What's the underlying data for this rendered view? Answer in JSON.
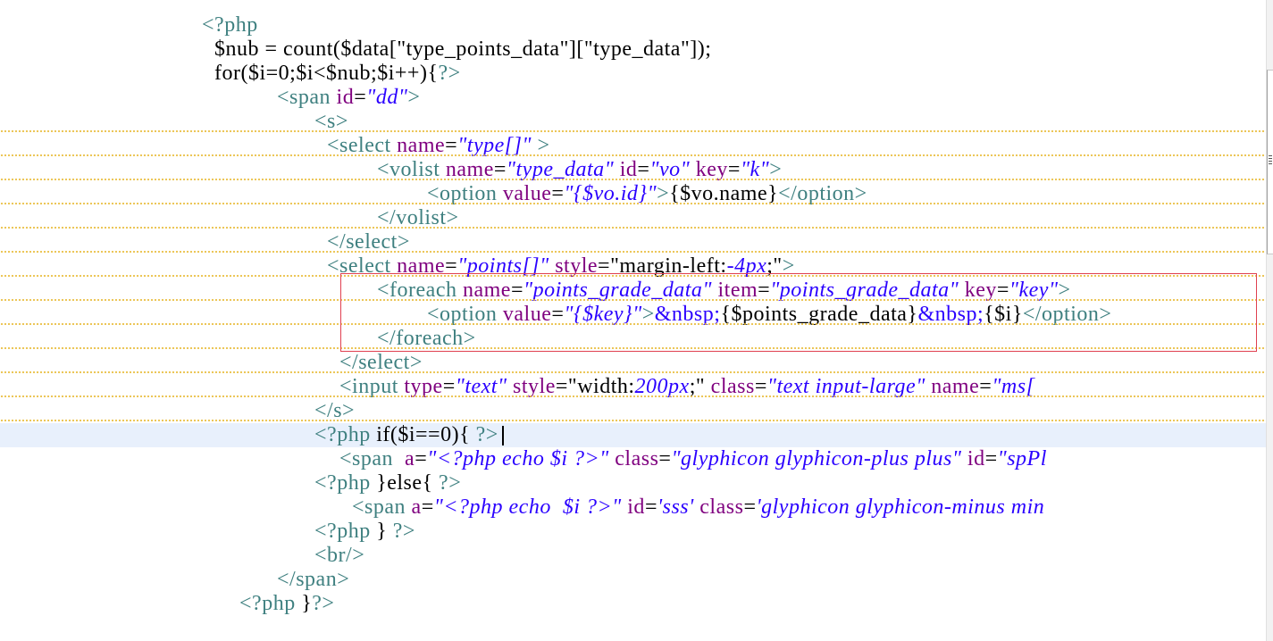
{
  "editor": {
    "language": "php/html template",
    "current_line": 17,
    "lines": [
      {
        "n": 1,
        "tokens": [
          {
            "t": "php",
            "v": "<?php"
          }
        ]
      },
      {
        "n": 2,
        "tokens": [
          {
            "t": "txt",
            "v": "$nub = count($data[\"type_points_data\"][\"type_data\"]);"
          }
        ]
      },
      {
        "n": 3,
        "tokens": [
          {
            "t": "txt",
            "v": "for($i=0;$i<$nub;$i++){"
          },
          {
            "t": "php",
            "v": "?>"
          }
        ]
      },
      {
        "n": 4,
        "tokens": [
          {
            "t": "tag",
            "v": "<span "
          },
          {
            "t": "attr",
            "v": "id"
          },
          {
            "t": "txt",
            "v": "="
          },
          {
            "t": "val",
            "v": "\"dd\""
          },
          {
            "t": "tag",
            "v": ">"
          }
        ]
      },
      {
        "n": 5,
        "tokens": [
          {
            "t": "tag",
            "v": "<s>"
          }
        ]
      },
      {
        "n": 6,
        "tokens": [
          {
            "t": "tag",
            "v": "<select "
          },
          {
            "t": "attr",
            "v": "name"
          },
          {
            "t": "txt",
            "v": "="
          },
          {
            "t": "val",
            "v": "\"type[]\""
          },
          {
            "t": "tag",
            "v": " >"
          }
        ]
      },
      {
        "n": 7,
        "tokens": [
          {
            "t": "tag",
            "v": "<volist "
          },
          {
            "t": "attr",
            "v": "name"
          },
          {
            "t": "txt",
            "v": "="
          },
          {
            "t": "val",
            "v": "\"type_data\""
          },
          {
            "t": "attr",
            "v": " id"
          },
          {
            "t": "txt",
            "v": "="
          },
          {
            "t": "val",
            "v": "\"vo\""
          },
          {
            "t": "attr",
            "v": " key"
          },
          {
            "t": "txt",
            "v": "="
          },
          {
            "t": "val",
            "v": "\"k\""
          },
          {
            "t": "tag",
            "v": ">"
          }
        ]
      },
      {
        "n": 8,
        "tokens": [
          {
            "t": "tag",
            "v": "<option "
          },
          {
            "t": "attr",
            "v": "value"
          },
          {
            "t": "txt",
            "v": "="
          },
          {
            "t": "val",
            "v": "\"{$vo.id}\""
          },
          {
            "t": "tag",
            "v": ">"
          },
          {
            "t": "txt",
            "v": "{$vo.name}"
          },
          {
            "t": "tag",
            "v": "</option>"
          }
        ]
      },
      {
        "n": 9,
        "tokens": [
          {
            "t": "tag",
            "v": "</volist>"
          }
        ]
      },
      {
        "n": 10,
        "tokens": [
          {
            "t": "tag",
            "v": "</select>"
          }
        ]
      },
      {
        "n": 11,
        "tokens": [
          {
            "t": "tag",
            "v": "<select "
          },
          {
            "t": "attr",
            "v": "name"
          },
          {
            "t": "txt",
            "v": "="
          },
          {
            "t": "val",
            "v": "\"points[]\""
          },
          {
            "t": "attr",
            "v": " style"
          },
          {
            "t": "txt",
            "v": "=\"margin-left:"
          },
          {
            "t": "val",
            "v": "-4px"
          },
          {
            "t": "txt",
            "v": ";\""
          },
          {
            "t": "tag",
            "v": ">"
          }
        ]
      },
      {
        "n": 12,
        "tokens": [
          {
            "t": "tag",
            "v": "<foreach "
          },
          {
            "t": "attr",
            "v": "name"
          },
          {
            "t": "txt",
            "v": "="
          },
          {
            "t": "val",
            "v": "\"points_grade_data\""
          },
          {
            "t": "attr",
            "v": " item"
          },
          {
            "t": "txt",
            "v": "="
          },
          {
            "t": "val",
            "v": "\"points_grade_data\""
          },
          {
            "t": "attr",
            "v": " key"
          },
          {
            "t": "txt",
            "v": "="
          },
          {
            "t": "val",
            "v": "\"key\""
          },
          {
            "t": "tag",
            "v": ">"
          }
        ]
      },
      {
        "n": 13,
        "tokens": [
          {
            "t": "tag",
            "v": "<option "
          },
          {
            "t": "attr",
            "v": "value"
          },
          {
            "t": "txt",
            "v": "="
          },
          {
            "t": "val",
            "v": "\"{$key}\""
          },
          {
            "t": "tag",
            "v": ">"
          },
          {
            "t": "ent",
            "v": "&nbsp;"
          },
          {
            "t": "txt",
            "v": "{$points_grade_data}"
          },
          {
            "t": "ent",
            "v": "&nbsp;"
          },
          {
            "t": "txt",
            "v": "{$i}"
          },
          {
            "t": "tag",
            "v": "</option>"
          }
        ]
      },
      {
        "n": 14,
        "tokens": [
          {
            "t": "tag",
            "v": "</foreach>"
          }
        ]
      },
      {
        "n": 15,
        "tokens": [
          {
            "t": "tag",
            "v": "</select>"
          }
        ]
      },
      {
        "n": 16,
        "tokens": [
          {
            "t": "tag",
            "v": "<input "
          },
          {
            "t": "attr",
            "v": "type"
          },
          {
            "t": "txt",
            "v": "="
          },
          {
            "t": "val",
            "v": "\"text\""
          },
          {
            "t": "attr",
            "v": " style"
          },
          {
            "t": "txt",
            "v": "=\"width:"
          },
          {
            "t": "val",
            "v": "200px"
          },
          {
            "t": "txt",
            "v": ";\""
          },
          {
            "t": "attr",
            "v": " class"
          },
          {
            "t": "txt",
            "v": "="
          },
          {
            "t": "val",
            "v": "\"text input-large\""
          },
          {
            "t": "attr",
            "v": " name"
          },
          {
            "t": "txt",
            "v": "="
          },
          {
            "t": "val",
            "v": "\"ms["
          }
        ]
      },
      {
        "n": 17,
        "tokens": [
          {
            "t": "php",
            "v": "</s>"
          }
        ]
      },
      {
        "n": 18,
        "tokens": [
          {
            "t": "php",
            "v": "<?php "
          },
          {
            "t": "txt",
            "v": "if($i==0){ "
          },
          {
            "t": "php",
            "v": "?>"
          }
        ]
      },
      {
        "n": 19,
        "tokens": [
          {
            "t": "tag",
            "v": "<span  "
          },
          {
            "t": "attr",
            "v": "a"
          },
          {
            "t": "txt",
            "v": "="
          },
          {
            "t": "val",
            "v": "\"<?php echo $i ?>\""
          },
          {
            "t": "attr",
            "v": " class"
          },
          {
            "t": "txt",
            "v": "="
          },
          {
            "t": "val",
            "v": "\"glyphicon glyphicon-plus plus\""
          },
          {
            "t": "attr",
            "v": " id"
          },
          {
            "t": "txt",
            "v": "="
          },
          {
            "t": "val",
            "v": "\"spPl"
          }
        ]
      },
      {
        "n": 20,
        "tokens": [
          {
            "t": "php",
            "v": "<?php "
          },
          {
            "t": "txt",
            "v": "}else{ "
          },
          {
            "t": "php",
            "v": "?>"
          }
        ]
      },
      {
        "n": 21,
        "tokens": [
          {
            "t": "tag",
            "v": "<span "
          },
          {
            "t": "attr",
            "v": "a"
          },
          {
            "t": "txt",
            "v": "="
          },
          {
            "t": "val",
            "v": "\"<?php echo  $i ?>\""
          },
          {
            "t": "attr",
            "v": " id"
          },
          {
            "t": "txt",
            "v": "="
          },
          {
            "t": "val",
            "v": "'sss'"
          },
          {
            "t": "attr",
            "v": " class"
          },
          {
            "t": "txt",
            "v": "="
          },
          {
            "t": "val",
            "v": "'glyphicon glyphicon-minus min"
          }
        ]
      },
      {
        "n": 22,
        "tokens": [
          {
            "t": "php",
            "v": "<?php "
          },
          {
            "t": "txt",
            "v": "} "
          },
          {
            "t": "php",
            "v": "?>"
          }
        ]
      },
      {
        "n": 23,
        "tokens": [
          {
            "t": "tag",
            "v": "<br/>"
          }
        ]
      },
      {
        "n": 24,
        "tokens": [
          {
            "t": "tag",
            "v": "</span>"
          }
        ]
      },
      {
        "n": 25,
        "tokens": [
          {
            "t": "php",
            "v": "<?php "
          },
          {
            "t": "txt",
            "v": "}"
          },
          {
            "t": "php",
            "v": "?>"
          }
        ]
      }
    ]
  },
  "highlight_box": {
    "label": "highlighted foreach block",
    "color": "#e04050",
    "lines": [
      12,
      14
    ]
  },
  "colors": {
    "tag": "#3f8080",
    "attribute": "#7f007f",
    "value": "#2a00ff",
    "text": "#000000",
    "current_line_bg": "#e8f0fc",
    "warning_squiggle": "#e8b830"
  }
}
